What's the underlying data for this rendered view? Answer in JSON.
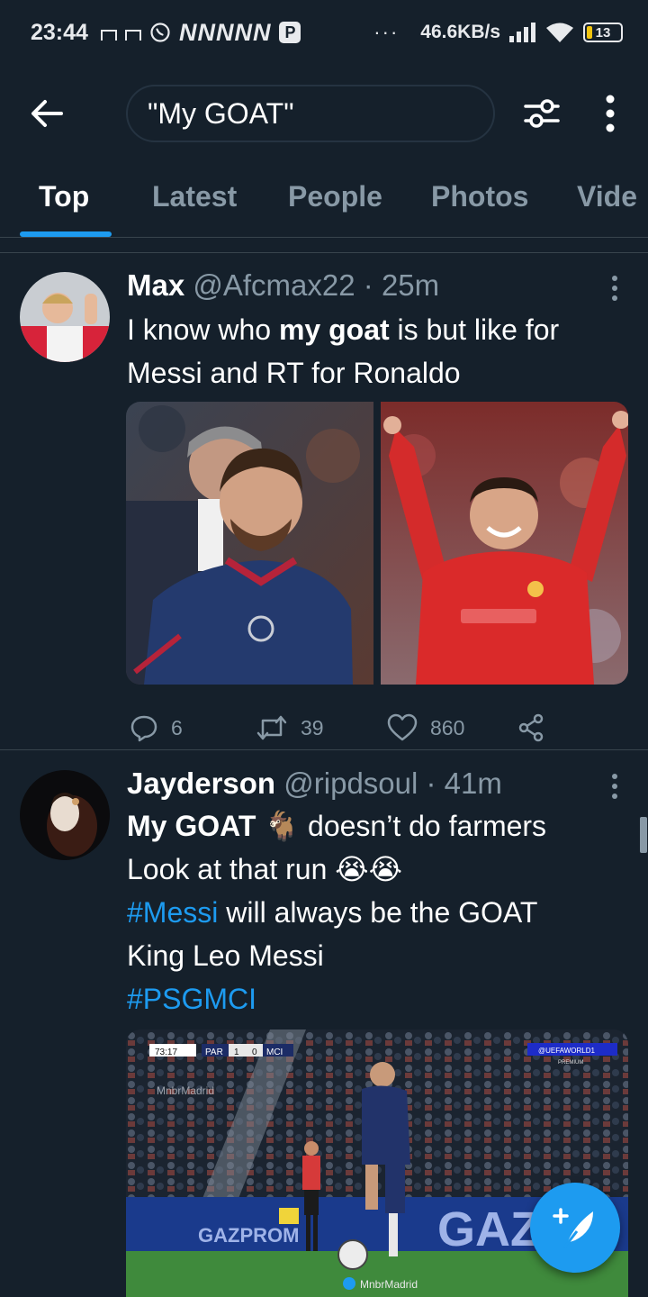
{
  "status_bar": {
    "time": "23:44",
    "notif_letters": "NNNNN",
    "p_badge": "P",
    "dots": "···",
    "speed": "46.6KB/s",
    "battery": "13"
  },
  "header": {
    "search_value": "\"My GOAT\""
  },
  "tabs": [
    "Top",
    "Latest",
    "People",
    "Photos",
    "Vide"
  ],
  "colors": {
    "background": "#15202b",
    "accent": "#1d9bf0",
    "muted": "#8899a6",
    "divider": "#38444d"
  },
  "tweets": [
    {
      "name": "Max",
      "handle": "@Afcmax22",
      "time": "· 25m",
      "text_plain_1": "I know who ",
      "text_bold": "my goat",
      "text_plain_2": " is but like for Messi and RT for Ronaldo",
      "replies": "6",
      "retweets": "39",
      "likes": "860"
    },
    {
      "name": "Jayderson",
      "handle": "@ripdsoul",
      "time": "· 41m",
      "line1_bold": "My GOAT",
      "line1_emoji": "🐐",
      "line1_rest": " doesn’t do farmers",
      "line2": "Look at that run ",
      "line2_emoji": "😭😭",
      "line3_tag": "#Messi",
      "line3_rest": " will always be the GOAT",
      "line4": "King Leo Messi",
      "line5_tag": "#PSGMCI",
      "video": {
        "scoreboard_time": "73:17",
        "team_home": "PAR",
        "score_home": "1",
        "score_away": "0",
        "team_away": "MCI",
        "broadcaster": "@UEFAWORLD1",
        "premium": "PREMIUM",
        "watermark_top": "MnbrMadrid",
        "watermark_bottom": "MnbrMadrid",
        "board_text": "GAZP",
        "board_logo": "GAZPROM"
      }
    }
  ]
}
